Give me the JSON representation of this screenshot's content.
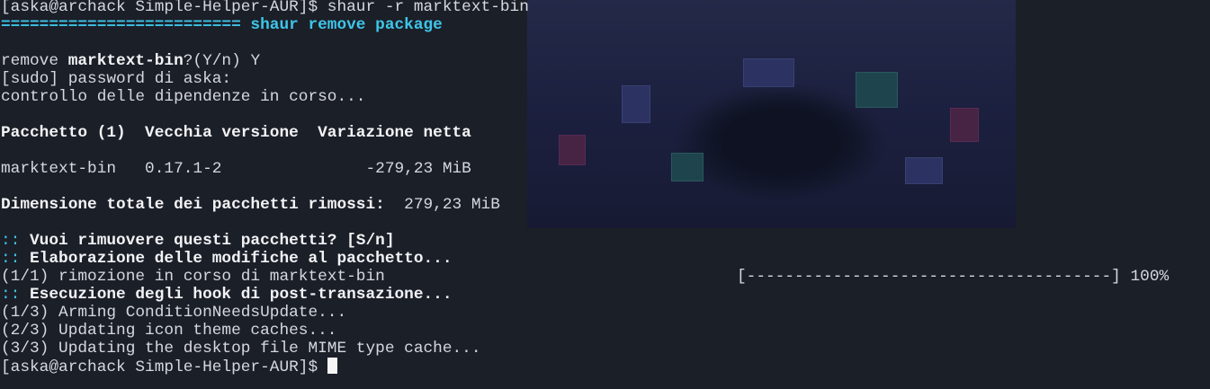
{
  "prompt": "[aska@archack Simple-Helper-AUR]$ ",
  "command": "shaur -r marktext-bin",
  "header": {
    "rule": "=========================",
    "title": " shaur remove package"
  },
  "confirm_remove": {
    "prefix": "remove ",
    "package": "marktext-bin",
    "suffix": "?(Y/n) Y"
  },
  "sudo_prompt": "[sudo] password di aska:",
  "deps_check": "controllo delle dipendenze in corso...",
  "table": {
    "headers": "Pacchetto (1)  Vecchia versione  Variazione netta",
    "row": "marktext-bin   0.17.1-2               -279,23 MiB"
  },
  "total": {
    "label": "Dimensione totale dei pacchetti rimossi:",
    "value": "  279,23 MiB"
  },
  "questions": [
    {
      "marker": ":: ",
      "text": "Vuoi rimuovere questi pacchetti? [S/n]"
    },
    {
      "marker": ":: ",
      "text": "Elaborazione delle modifiche al pacchetto..."
    }
  ],
  "progress": {
    "text": "(1/1) rimozione in corso di marktext-bin",
    "bar": "[--------------------------------------] 100%"
  },
  "hooks": {
    "marker": ":: ",
    "text": "Esecuzione degli hook di post-transazione..."
  },
  "hook_steps": [
    "(1/3) Arming ConditionNeedsUpdate...",
    "(2/3) Updating icon theme caches...",
    "(3/3) Updating the desktop file MIME type cache..."
  ]
}
